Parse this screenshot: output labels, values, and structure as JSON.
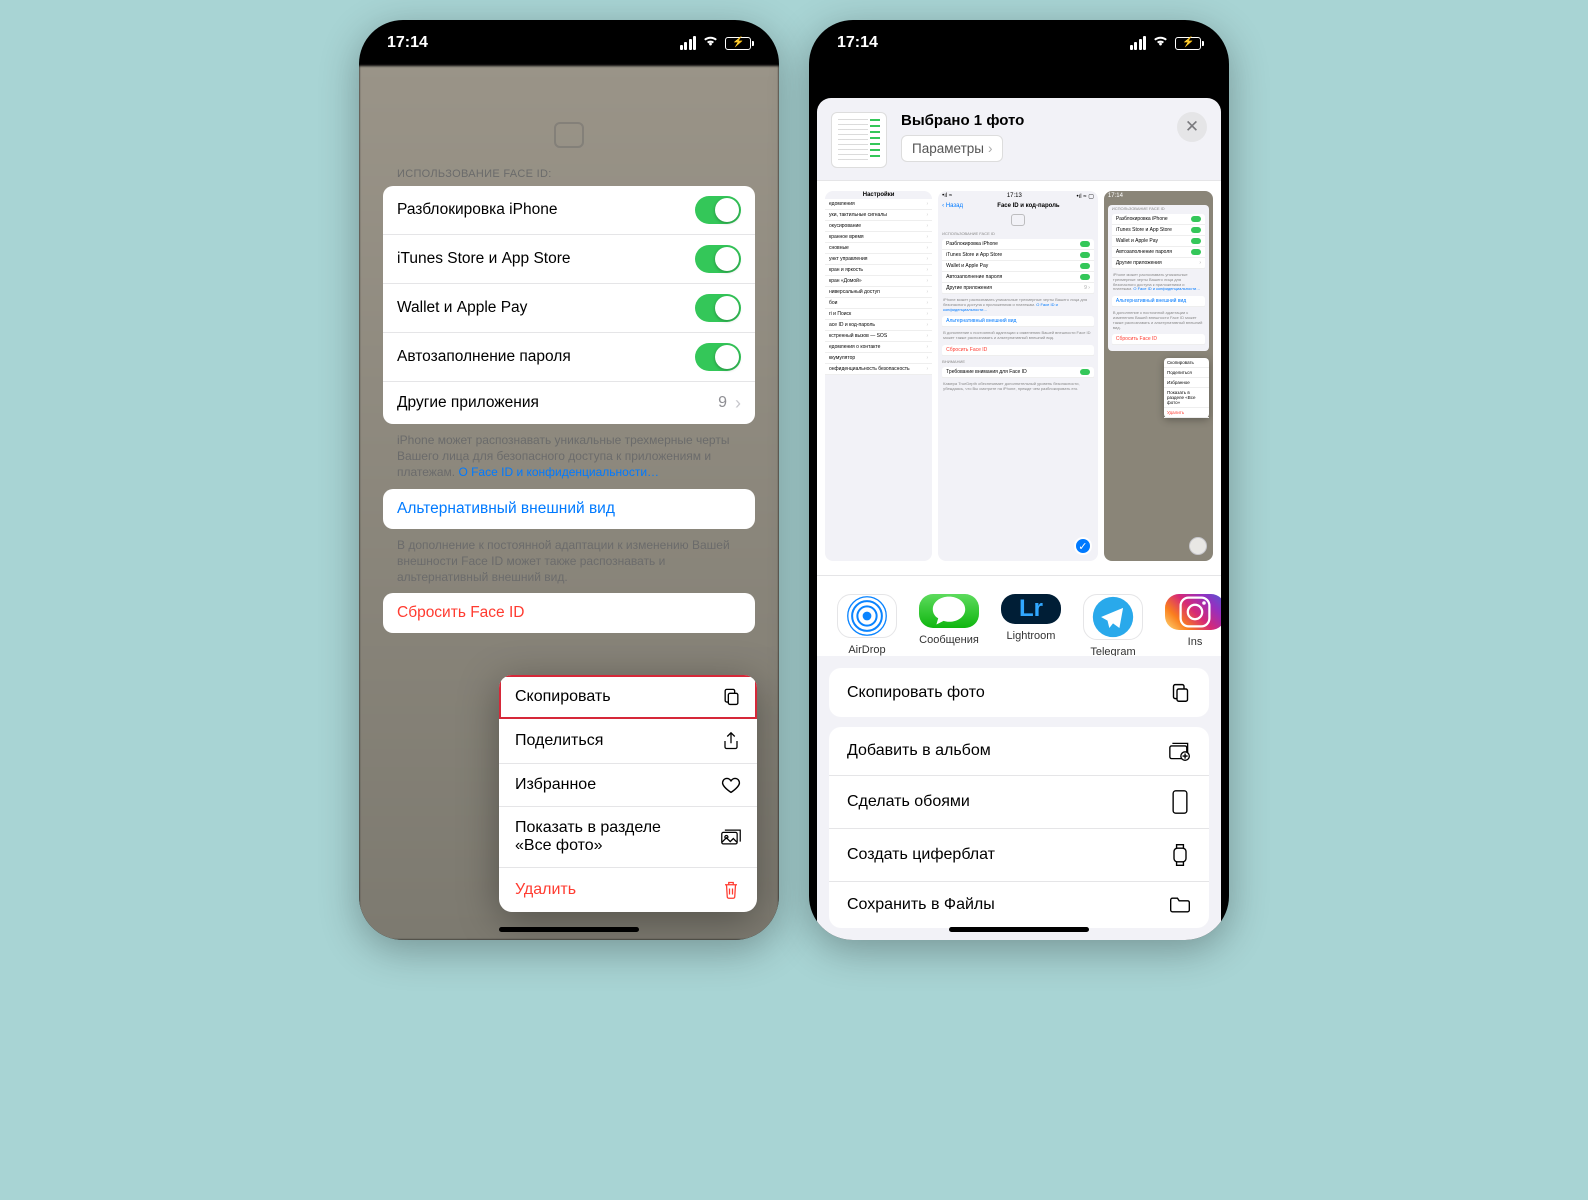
{
  "status": {
    "time": "17:14"
  },
  "phone1": {
    "section_header": "ИСПОЛЬЗОВАНИЕ FACE ID:",
    "rows": {
      "unlock": "Разблокировка iPhone",
      "itunes": "iTunes Store и App Store",
      "wallet": "Wallet и Apple Pay",
      "autofill": "Автозаполнение пароля",
      "other_apps": "Другие приложения",
      "other_apps_count": "9"
    },
    "footnote1_text": "iPhone может распознавать уникальные трехмерные черты Вашего лица для безопасного доступа к приложениям и платежам. ",
    "footnote1_link": "О Face ID и конфиденциальности…",
    "alt_appearance": "Альтернативный внешний вид",
    "footnote2": "В дополнение к постоянной адаптации к изменению Вашей внешности Face ID может также распознавать и альтернативный внешний вид.",
    "reset": "Сбросить Face ID",
    "context_menu": {
      "copy": "Скопировать",
      "share": "Поделиться",
      "favorite": "Избранное",
      "show_all": "Показать в разделе «Все фото»",
      "delete": "Удалить"
    }
  },
  "phone2": {
    "header_title": "Выбрано 1 фото",
    "options_btn": "Параметры",
    "apps": {
      "airdrop": "AirDrop",
      "messages": "Сообщения",
      "lightroom": "Lightroom",
      "telegram": "Telegram",
      "instagram": "Ins"
    },
    "actions": {
      "copy_photo": "Скопировать фото",
      "add_album": "Добавить в альбом",
      "wallpaper": "Сделать обоями",
      "watchface": "Создать циферблат",
      "save_files": "Сохранить в Файлы"
    },
    "previews": {
      "left": {
        "title": "Настройки",
        "items": [
          "едомления",
          "уки, тактильные сигналы",
          "окусирование",
          "кранное время",
          "сновные",
          "ункт управления",
          "кран и яркость",
          "кран «Домой»",
          "ниверсальный доступ",
          "бои",
          "ri и Поиск",
          "ace ID и код-пароль",
          "кстренный вызов — SOS",
          "едомления о контакте",
          "ккумулятор",
          "онфиденциальность безопасность"
        ]
      },
      "mid": {
        "time": "17:13",
        "back": "Назад",
        "title": "Face ID и код-пароль",
        "section": "ИСПОЛЬЗОВАНИЕ FACE ID",
        "rows": [
          "Разблокировка iPhone",
          "iTunes Store и App Store",
          "Wallet и Apple Pay",
          "Автозаполнение пароля",
          "Другие приложения"
        ],
        "count": "9",
        "foot": "iPhone может распознавать уникальные трехмерные черты Вашего лица для безопасного доступа к приложениям и платежам.",
        "foot_link": " О Face ID и конфиденциальности…",
        "alt": "Альтернативный внешний вид",
        "foot2": "В дополнение к постоянной адаптации к изменению Вашей внешности Face ID может также распознавать и альтернативный внешний вид.",
        "reset": "Сбросить Face ID",
        "attention_hdr": "ВНИМАНИЕ",
        "attention": "Требование внимания для Face ID",
        "attention_foot": "Камера TrueDepth обеспечивает дополнительный уровень безопасности, убеждаясь, что Вы смотрите на iPhone, прежде чем разблокировать его."
      },
      "right": {
        "time": "17:14",
        "section": "ИСПОЛЬЗОВАНИЕ FACE ID",
        "rows": [
          "Разблокировка iPhone",
          "iTunes Store и App Store",
          "Wallet и Apple Pay",
          "Автозаполнение пароля",
          "Другие приложения"
        ],
        "foot": "iPhone может распознавать уникальные трехмерные черты Вашего лица для безопасного доступа к приложениям и платежам.",
        "foot_link": " О Face ID и конфиденциальности…",
        "alt": "Альтернативный внешний вид",
        "foot2": "В дополнение к постоянной адаптации к изменению Вашей внешности Face ID может также распознавать и альтернативный внешний вид.",
        "reset": "Сбросить Face ID",
        "ctx": [
          "Скопировать",
          "Поделиться",
          "Избранное",
          "Показать в разделе «Все фото»",
          "Удалить"
        ]
      }
    }
  }
}
